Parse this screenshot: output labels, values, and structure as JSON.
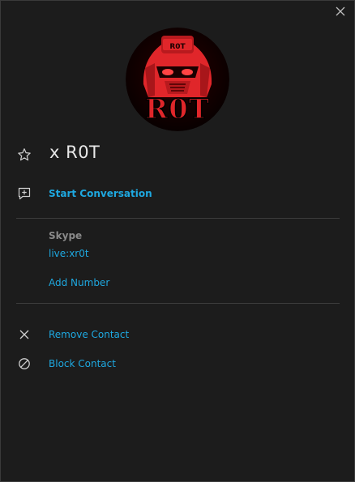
{
  "contact": {
    "name": "x R0T",
    "start_conversation": "Start Conversation",
    "skype_label": "Skype",
    "skype_id": "live:xr0t",
    "add_number": "Add Number",
    "remove_contact": "Remove Contact",
    "block_contact": "Block Contact"
  },
  "avatar": {
    "text": "R0T",
    "badge_text": "R0T"
  },
  "icons": {
    "close": "close-icon",
    "favorite": "star-icon",
    "start": "new-chat-icon",
    "remove": "x-icon",
    "block": "block-icon"
  },
  "colors": {
    "background": "#1c1c1c",
    "link": "#1ea8e0",
    "text": "#e6e6e6",
    "muted": "#8a8a8a",
    "divider": "#3c3c3c",
    "avatar_red": "#e0262a"
  }
}
